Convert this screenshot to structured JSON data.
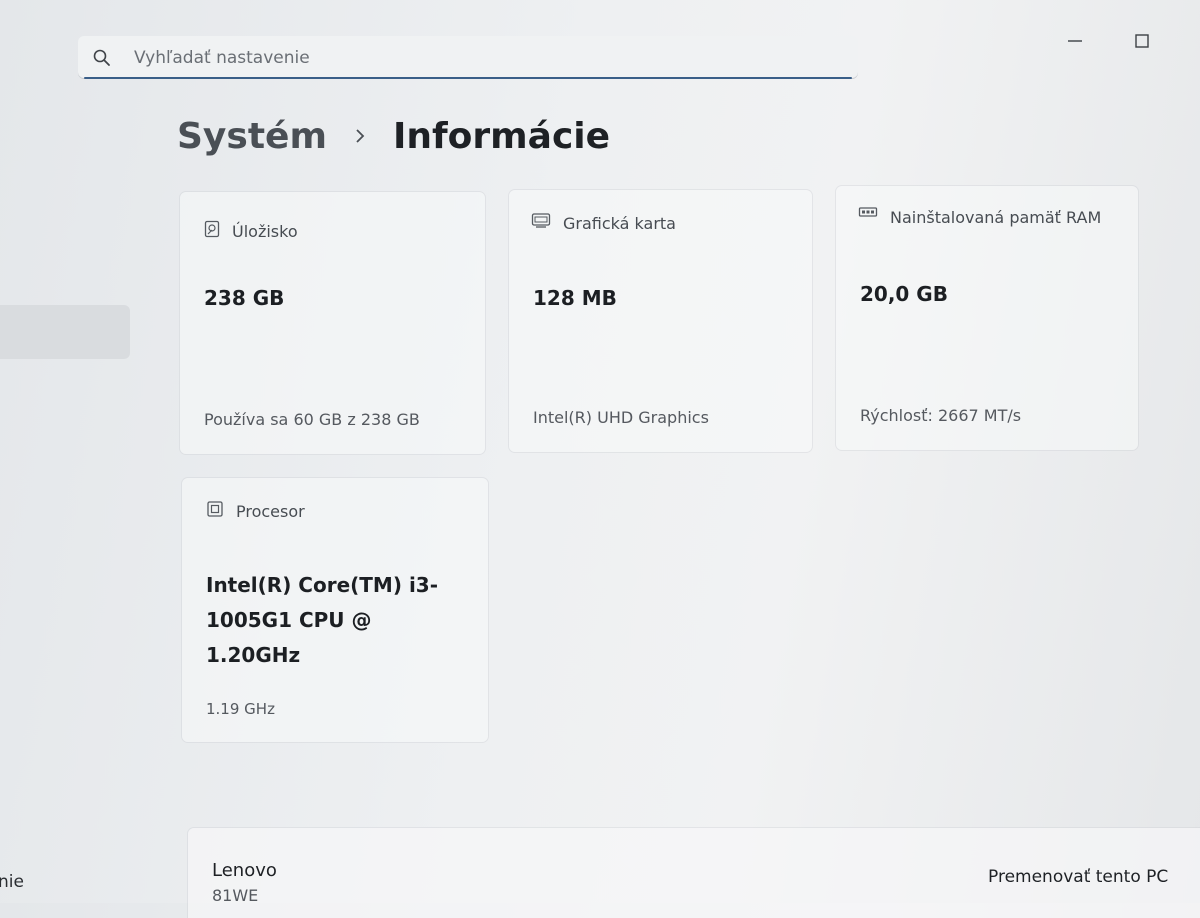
{
  "search": {
    "placeholder": "Vyhľadať nastavenie"
  },
  "breadcrumb": {
    "parent": "Systém",
    "current": "Informácie"
  },
  "cards": {
    "storage": {
      "label": "Úložisko",
      "value": "238 GB",
      "sub": "Používa sa 60 GB z 238 GB"
    },
    "gpu": {
      "label": "Grafická karta",
      "value": "128 MB",
      "sub": "Intel(R) UHD Graphics"
    },
    "ram": {
      "label": "Nainštalovaná pamäť RAM",
      "value": "20,0 GB",
      "sub": "Rýchlosť: 2667 MT/s"
    },
    "cpu": {
      "label": "Procesor",
      "value": "Intel(R) Core(TM) i3-1005G1 CPU @ 1.20GHz",
      "sub": "1.19 GHz"
    }
  },
  "device": {
    "name": "Lenovo",
    "model": "81WE",
    "rename_label": "Premenovať tento PC"
  },
  "sidebar": {
    "partial_label": "nie"
  },
  "icons": {
    "search": "search-icon",
    "minimize": "minimize-icon",
    "maximize": "maximize-icon",
    "chevron": "chevron-right-icon",
    "storage": "storage-icon",
    "gpu": "gpu-icon",
    "ram": "ram-icon",
    "cpu": "cpu-icon"
  },
  "colors": {
    "accent_underline": "#3a5f88",
    "text_primary": "#1e2125",
    "text_secondary": "#55595f"
  }
}
